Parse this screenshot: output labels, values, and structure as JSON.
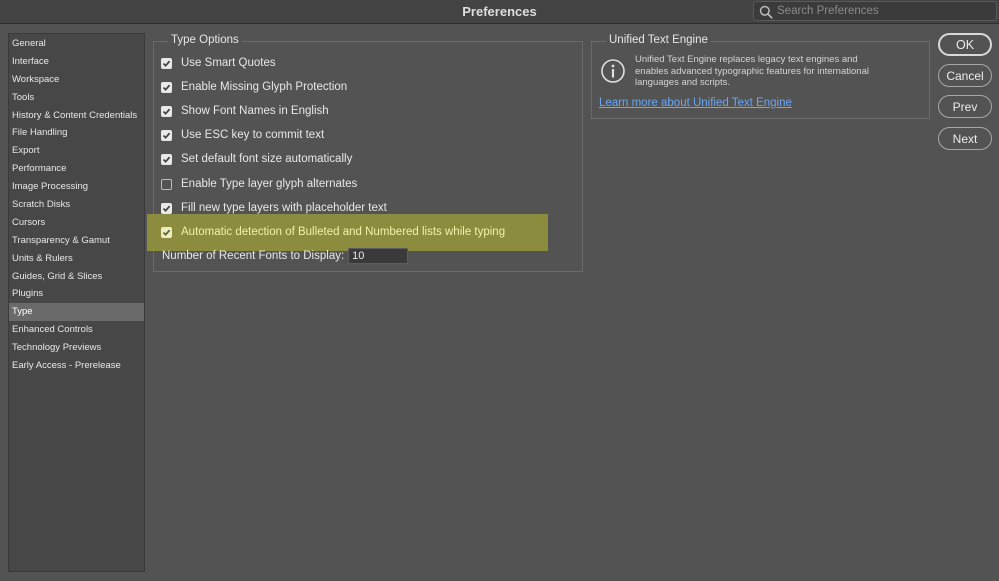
{
  "window": {
    "title": "Preferences"
  },
  "search": {
    "placeholder": "Search Preferences"
  },
  "sidebar": {
    "items": [
      {
        "label": "General",
        "selected": false
      },
      {
        "label": "Interface",
        "selected": false
      },
      {
        "label": "Workspace",
        "selected": false
      },
      {
        "label": "Tools",
        "selected": false
      },
      {
        "label": "History & Content Credentials",
        "selected": false
      },
      {
        "label": "File Handling",
        "selected": false
      },
      {
        "label": "Export",
        "selected": false
      },
      {
        "label": "Performance",
        "selected": false
      },
      {
        "label": "Image Processing",
        "selected": false
      },
      {
        "label": "Scratch Disks",
        "selected": false
      },
      {
        "label": "Cursors",
        "selected": false
      },
      {
        "label": "Transparency & Gamut",
        "selected": false
      },
      {
        "label": "Units & Rulers",
        "selected": false
      },
      {
        "label": "Guides, Grid & Slices",
        "selected": false
      },
      {
        "label": "Plugins",
        "selected": false
      },
      {
        "label": "Type",
        "selected": true
      },
      {
        "label": "Enhanced Controls",
        "selected": false
      },
      {
        "label": "Technology Previews",
        "selected": false
      },
      {
        "label": "Early Access - Prerelease",
        "selected": false
      }
    ]
  },
  "type_options": {
    "title": "Type Options",
    "options": [
      {
        "label": "Use Smart Quotes",
        "checked": true
      },
      {
        "label": "Enable Missing Glyph Protection",
        "checked": true
      },
      {
        "label": "Show Font Names in English",
        "checked": true
      },
      {
        "label": "Use ESC key to commit text",
        "checked": true
      },
      {
        "label": "Set default font size automatically",
        "checked": true
      },
      {
        "label": "Enable Type layer glyph alternates",
        "checked": false
      },
      {
        "label": "Fill new type layers with placeholder text",
        "checked": true
      },
      {
        "label": "Automatic detection of Bulleted and Numbered lists while typing",
        "checked": true,
        "highlighted": true
      }
    ],
    "recent_fonts_label": "Number of Recent Fonts to Display:",
    "recent_fonts_value": "10"
  },
  "unified_text_engine": {
    "title": "Unified Text Engine",
    "description": "Unified Text Engine replaces legacy text engines and enables advanced typographic features for international languages and scripts.",
    "link": "Learn more about Unified Text Engine"
  },
  "buttons": {
    "ok": "OK",
    "cancel": "Cancel",
    "prev": "Prev",
    "next": "Next"
  },
  "colors": {
    "background": "#535353",
    "highlight": "#8c8c3e",
    "highlight_text": "#f3f0a8",
    "link": "#6aa7f5"
  }
}
